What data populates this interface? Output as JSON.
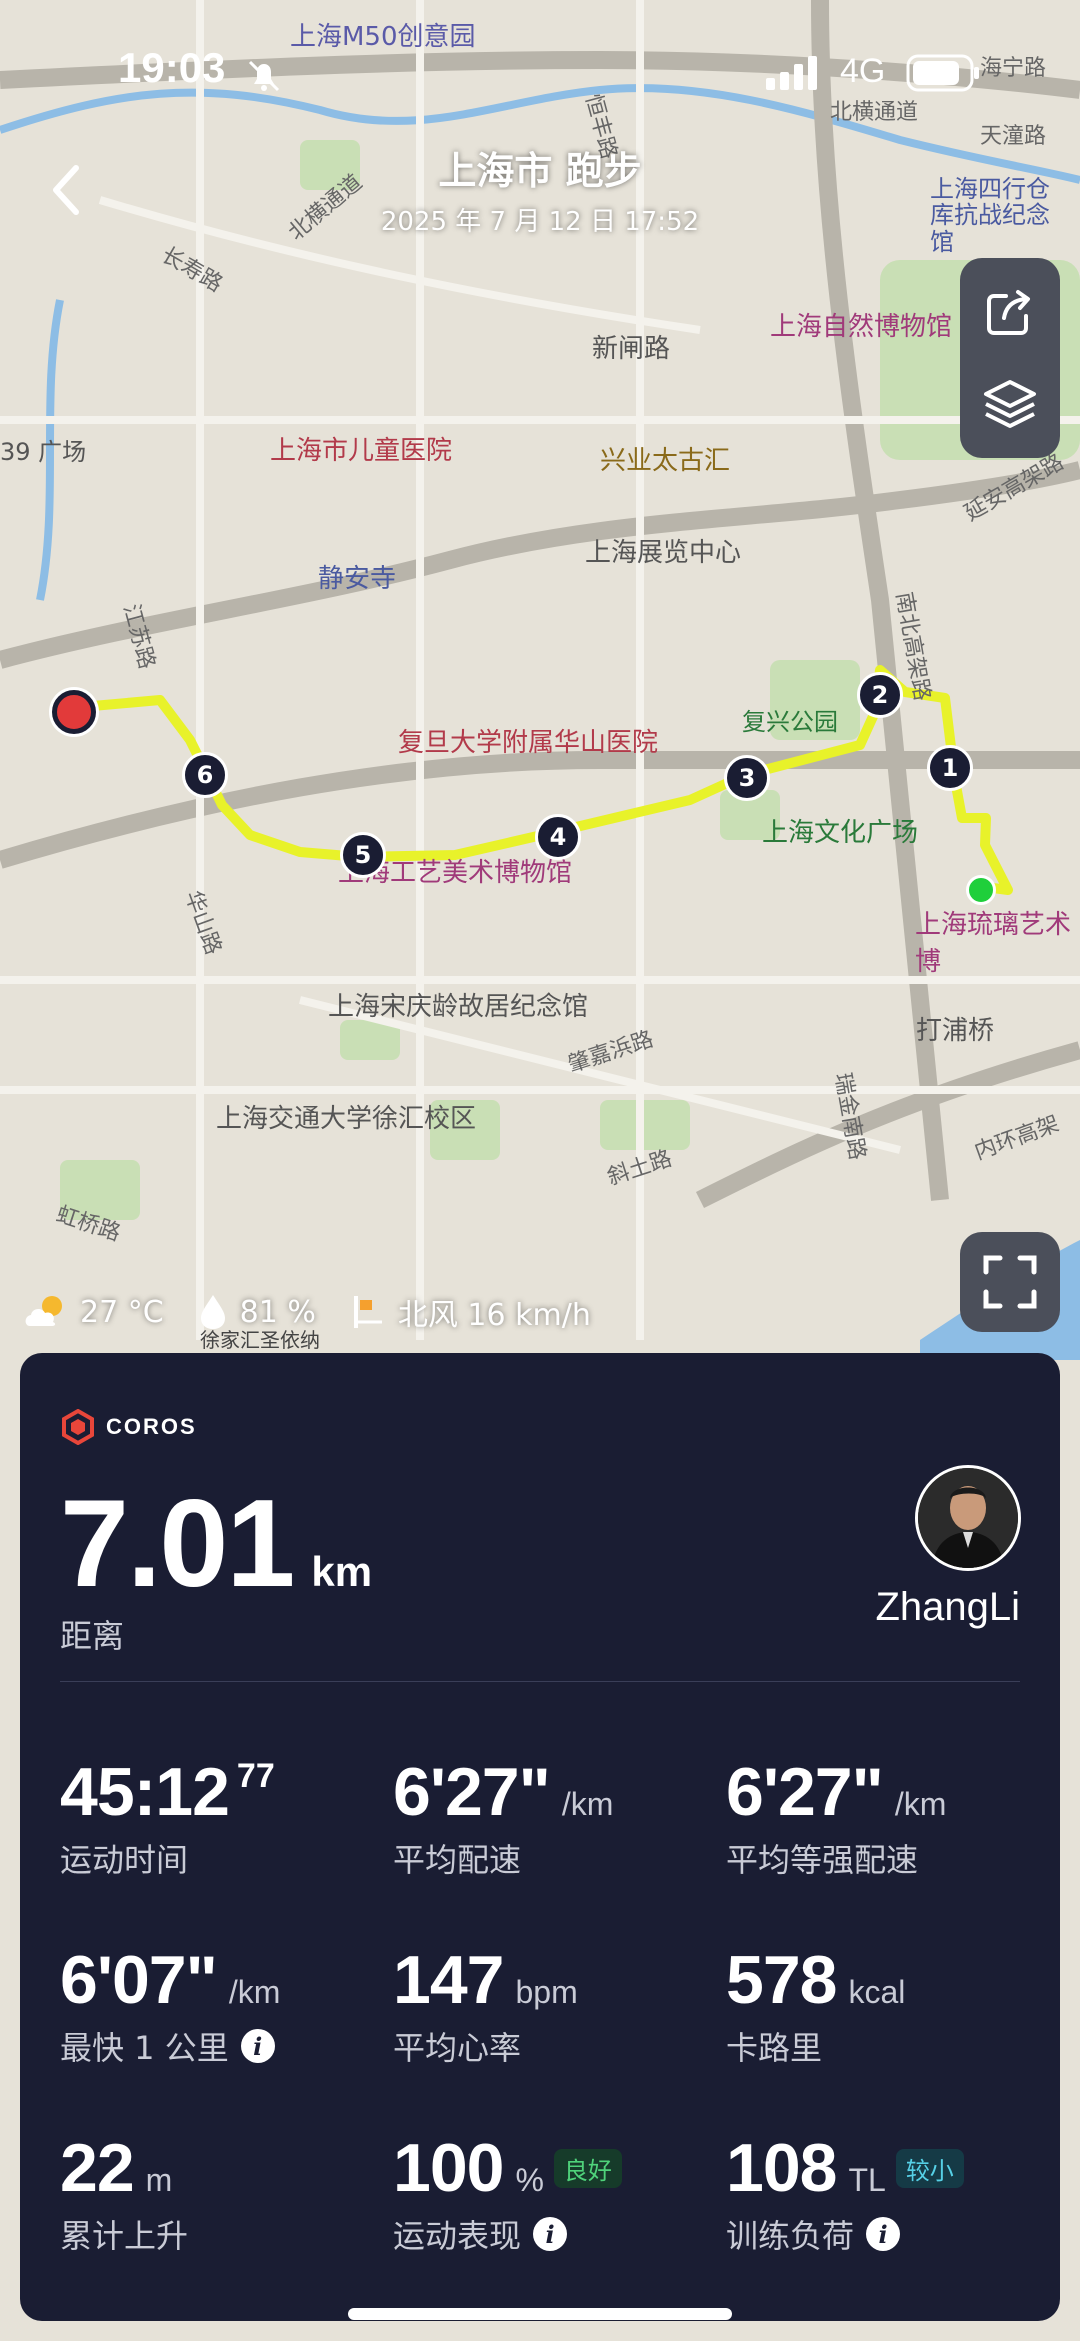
{
  "status_bar": {
    "time": "19:03",
    "network": "4G"
  },
  "header": {
    "title": "上海市 跑步",
    "subtitle": "2025 年 7 月 12 日 17:52"
  },
  "map_labels": [
    "上海M50创意园",
    "上海市儿童医院",
    "静安寺",
    "上海展览中心",
    "兴业太古汇",
    "新闸路",
    "上海自然博物馆",
    "上海四行仓库抗战纪念馆",
    "复兴公园",
    "上海文化广场",
    "复旦大学附属华山医院",
    "上海工艺美术博物馆",
    "上海宋庆龄故居纪念馆",
    "上海交通大学徐汇校区",
    "上海琉璃艺术博",
    "打浦桥",
    "肇嘉浜路",
    "斜土路",
    "华山路",
    "江苏路",
    "虹桥路",
    "北横通道",
    "长寿路",
    "39 广场",
    "延安高架路",
    "南北高架路",
    "瑞金南路",
    "内环高架",
    "天潼路",
    "北横通道",
    "海宁路",
    "恒丰路",
    "徐家汇圣依纳"
  ],
  "route_markers": [
    "1",
    "2",
    "3",
    "4",
    "5",
    "6"
  ],
  "weather": {
    "temp": "27 °C",
    "humidity": "81 %",
    "wind": "北风 16 km/h"
  },
  "card": {
    "brand": "COROS",
    "distance": {
      "value": "7.01",
      "unit": "km",
      "label": "距离"
    },
    "user": {
      "name": "ZhangLi"
    },
    "metrics": [
      {
        "value": "45:12",
        "sup": "77",
        "unit": "",
        "label": "运动时间"
      },
      {
        "value": "6'27\"",
        "unit": "/km",
        "label": "平均配速"
      },
      {
        "value": "6'27\"",
        "unit": "/km",
        "label": "平均等强配速"
      },
      {
        "value": "6'07\"",
        "unit": "/km",
        "label": "最快 1 公里"
      },
      {
        "value": "147",
        "unit": "bpm",
        "label": "平均心率"
      },
      {
        "value": "578",
        "unit": "kcal",
        "label": "卡路里"
      },
      {
        "value": "22",
        "unit": "m",
        "label": "累计上升"
      },
      {
        "value": "100",
        "unit": "%",
        "label": "运动表现",
        "badge": "良好"
      },
      {
        "value": "108",
        "unit": "TL",
        "label": "训练负荷",
        "badge": "较小"
      }
    ]
  },
  "colors": {
    "route": "#e8f22a",
    "card_bg": "#1a1d33",
    "start": "#1fcf3b",
    "end": "#e23a3a",
    "brand": "#e8463a"
  }
}
